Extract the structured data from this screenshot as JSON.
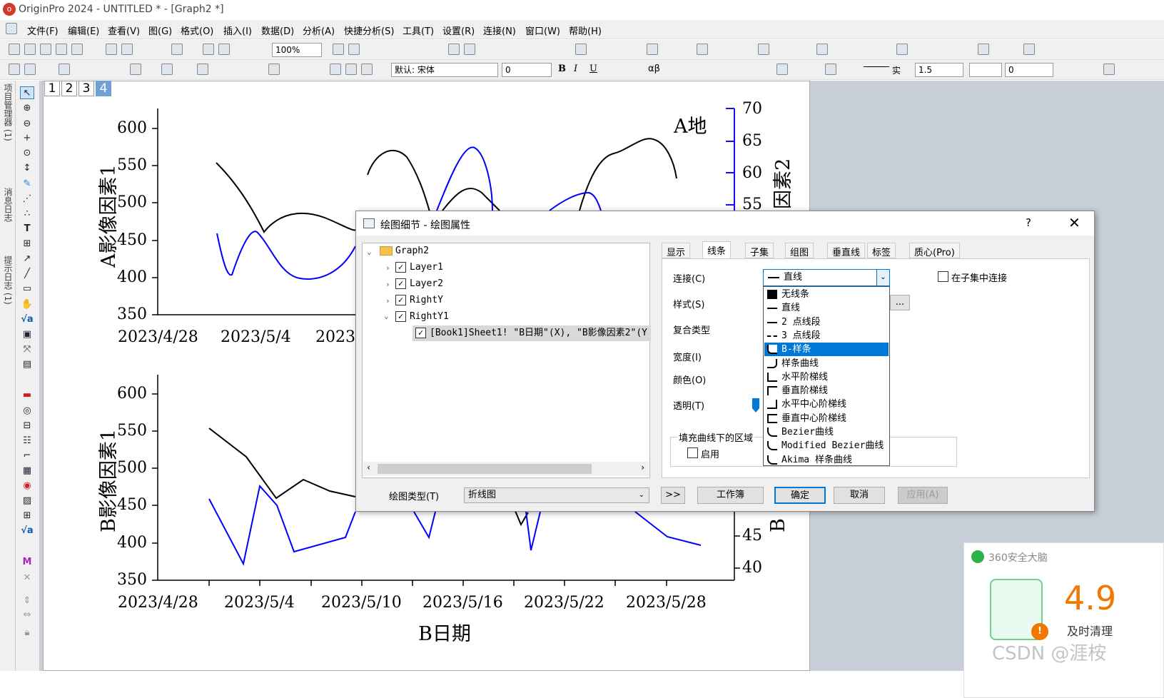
{
  "window": {
    "title": "OriginPro 2024 - UNTITLED * - [Graph2 *]"
  },
  "menubar": [
    "文件(F)",
    "编辑(E)",
    "查看(V)",
    "图(G)",
    "格式(O)",
    "插入(I)",
    "数据(D)",
    "分析(A)",
    "快捷分析(S)",
    "工具(T)",
    "设置(R)",
    "连接(N)",
    "窗口(W)",
    "帮助(H)"
  ],
  "toolbar": {
    "zoom": "100%",
    "font": "默认: 宋体",
    "font_size": "0",
    "line_style": "实",
    "line_width": "1.5",
    "extra_value": "0"
  },
  "left_panels": [
    "项目管理器 (1)",
    "消息日志",
    "提示日志 (1)"
  ],
  "layer_tabs": [
    "1",
    "2",
    "3",
    "4"
  ],
  "graph": {
    "top": {
      "ylabel": "A影像因素1",
      "legend": "A地",
      "right_label": "因素2",
      "yticks": [
        "600",
        "550",
        "500",
        "450",
        "400",
        "350"
      ],
      "right_ticks": [
        "70",
        "65",
        "60",
        "55"
      ],
      "xticks": [
        "2023/4/28",
        "2023/5/4",
        "2023/"
      ]
    },
    "bottom": {
      "ylabel": "B影像因素1",
      "right_label": "B",
      "yticks": [
        "600",
        "550",
        "500",
        "450",
        "400",
        "350"
      ],
      "right_ticks": [
        "45",
        "40"
      ],
      "xticks": [
        "2023/4/28",
        "2023/5/4",
        "2023/5/10",
        "2023/5/16",
        "2023/5/22",
        "2023/5/28"
      ],
      "xlabel": "B日期"
    }
  },
  "dialog": {
    "title": "绘图细节 - 绘图属性",
    "help": "?",
    "close": "✕",
    "tree": {
      "root": "Graph2",
      "items": [
        "Layer1",
        "Layer2",
        "RightY",
        "RightY1"
      ],
      "plot": "[Book1]Sheet1! \"B日期\"(X), \"B影像因素2\"(Y"
    },
    "tabs": [
      "显示",
      "线条",
      "子集",
      "组图",
      "垂直线",
      "标签",
      "质心(Pro)"
    ],
    "active_tab": "线条",
    "labels": {
      "connect": "连接(C)",
      "style": "样式(S)",
      "composite": "复合类型",
      "width": "宽度(I)",
      "color": "颜色(O)",
      "transparency": "透明(T)",
      "fill_area": "填充曲线下的区域",
      "enable": "启用",
      "subset_connect": "在子集中连接",
      "ellipsis": "..."
    },
    "connect_value": "直线",
    "connect_options": [
      "无线条",
      "直线",
      "2 点线段",
      "3 点线段",
      "B-样条",
      "样条曲线",
      "水平阶梯线",
      "垂直阶梯线",
      "水平中心阶梯线",
      "垂直中心阶梯线",
      "Bezier曲线",
      "Modified Bezier曲线",
      "Akima 样条曲线"
    ],
    "selected_option": "B-样条",
    "plot_type_label": "绘图类型(T)",
    "plot_type": "折线图",
    "buttons": {
      "expand": ">>",
      "workbook": "工作簿",
      "ok": "确定",
      "cancel": "取消",
      "apply": "应用(A)"
    }
  },
  "popup": {
    "title": "360安全大脑",
    "score": "4.9",
    "subtitle": "及时清理"
  },
  "watermark": "CSDN @涯桉"
}
